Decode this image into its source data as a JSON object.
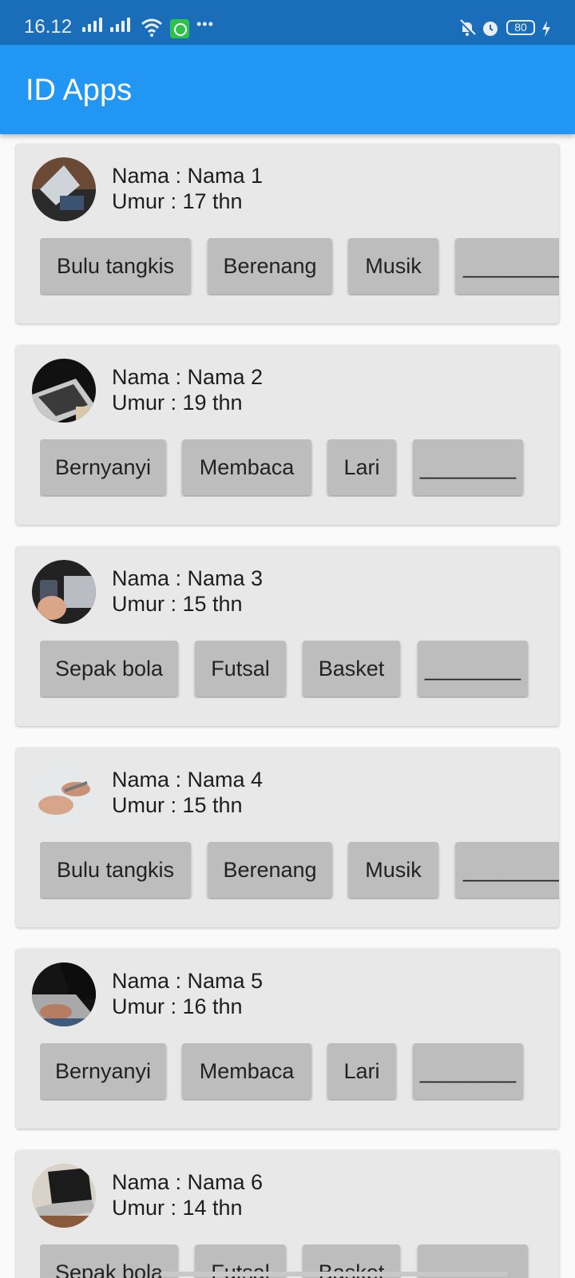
{
  "status_bar": {
    "time": "16.12",
    "battery": "80"
  },
  "app_bar": {
    "title": "ID Apps"
  },
  "icons": {
    "signal": "signal-icon",
    "wifi": "wifi-icon",
    "whatsapp": "whatsapp-icon",
    "more": "more-icon",
    "bell_off": "bell-off-icon",
    "alarm": "alarm-icon",
    "battery": "battery-icon",
    "charging": "bolt-icon"
  },
  "cards": [
    {
      "nama": "Nama : Nama 1",
      "umur": "Umur  : 17 thn",
      "chips": [
        "Bulu tangkis",
        "Berenang",
        "Musik",
        "________"
      ]
    },
    {
      "nama": "Nama : Nama 2",
      "umur": "Umur  : 19 thn",
      "chips": [
        "Bernyanyi",
        "Membaca",
        "Lari",
        "________"
      ]
    },
    {
      "nama": "Nama : Nama 3",
      "umur": "Umur  : 15 thn",
      "chips": [
        "Sepak bola",
        "Futsal",
        "Basket",
        "________"
      ]
    },
    {
      "nama": "Nama : Nama 4",
      "umur": "Umur  : 15 thn",
      "chips": [
        "Bulu tangkis",
        "Berenang",
        "Musik",
        "________"
      ]
    },
    {
      "nama": "Nama : Nama 5",
      "umur": "Umur  : 16 thn",
      "chips": [
        "Bernyanyi",
        "Membaca",
        "Lari",
        "________"
      ]
    },
    {
      "nama": "Nama : Nama 6",
      "umur": "Umur  : 14 thn",
      "chips": [
        "Sepak bola",
        "Futsal",
        "Basket",
        "________"
      ]
    }
  ]
}
